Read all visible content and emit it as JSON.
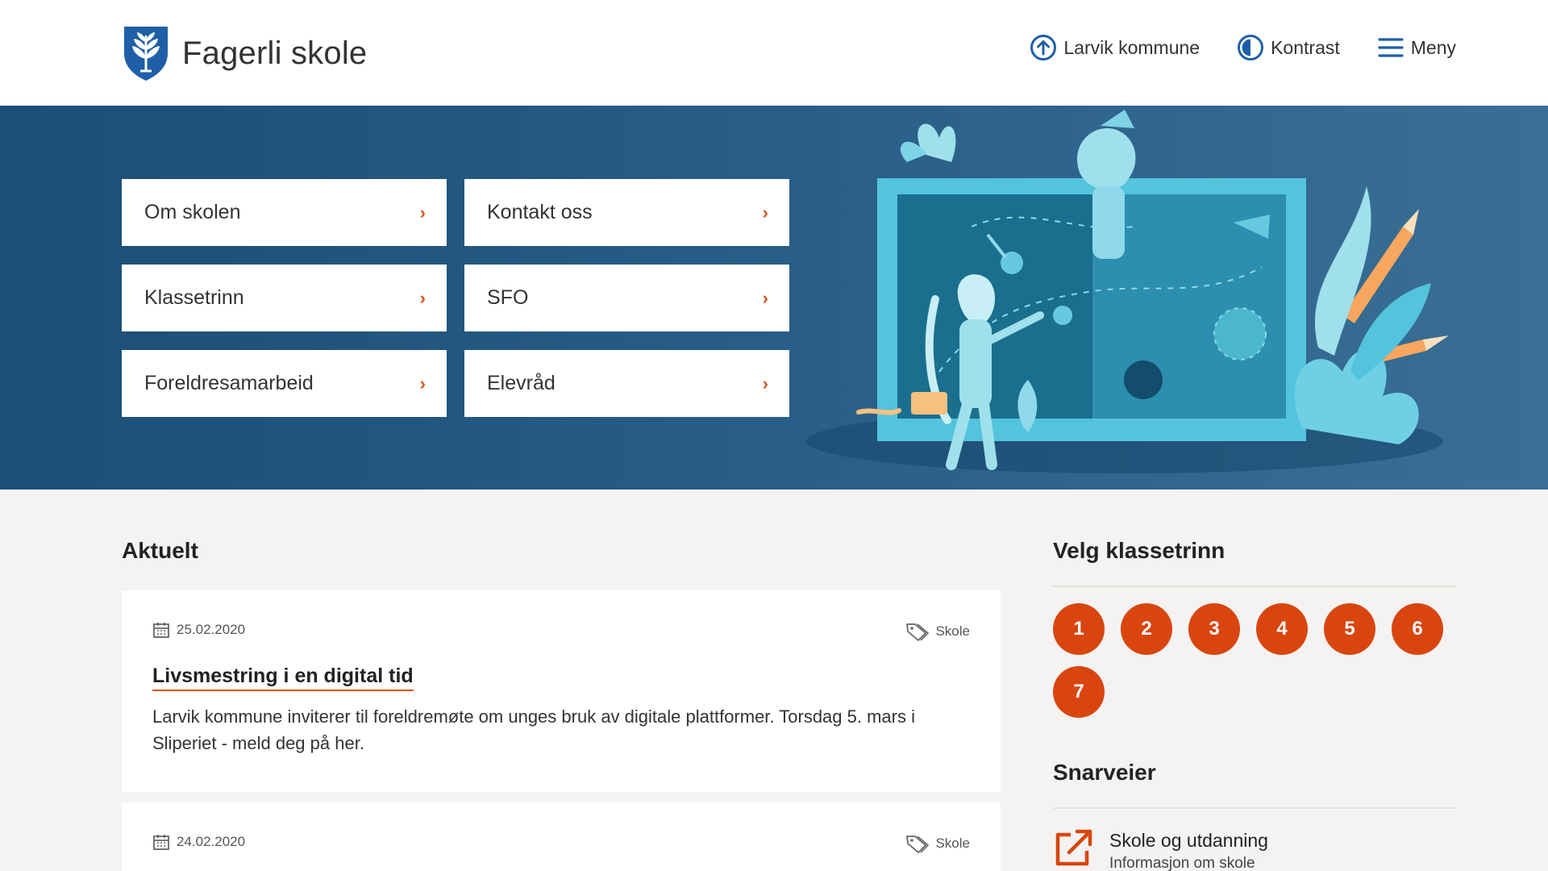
{
  "header": {
    "site_title": "Fagerli skole",
    "nav": [
      {
        "label": "Larvik kommune",
        "icon": "arrow-up-circle-icon"
      },
      {
        "label": "Kontrast",
        "icon": "contrast-icon"
      },
      {
        "label": "Meny",
        "icon": "hamburger-menu-icon"
      }
    ],
    "icon_color": "#1f5fa8"
  },
  "hero": {
    "links": [
      {
        "label": "Om skolen"
      },
      {
        "label": "Kontakt oss"
      },
      {
        "label": "Klassetrinn"
      },
      {
        "label": "SFO"
      },
      {
        "label": "Foreldresamarbeid"
      },
      {
        "label": "Elevråd"
      }
    ],
    "chevron": "›",
    "background": "#1c4e76"
  },
  "news": {
    "title": "Aktuelt",
    "items": [
      {
        "date": "25.02.2020",
        "tag": "Skole",
        "title": "Livsmestring i en digital tid",
        "text": "Larvik kommune inviterer til foreldremøte om unges bruk av digitale plattformer. Torsdag 5. mars i Sliperiet - meld deg på her."
      },
      {
        "date": "24.02.2020",
        "tag": "Skole"
      }
    ]
  },
  "grades": {
    "title": "Velg klassetrinn",
    "items": [
      "1",
      "2",
      "3",
      "4",
      "5",
      "6",
      "7"
    ],
    "color": "#d9450f"
  },
  "shortcuts": {
    "title": "Snarveier",
    "items": [
      {
        "label": "Skole og utdanning",
        "desc": "Informasjon om skole",
        "icon": "external-link-icon"
      }
    ]
  }
}
